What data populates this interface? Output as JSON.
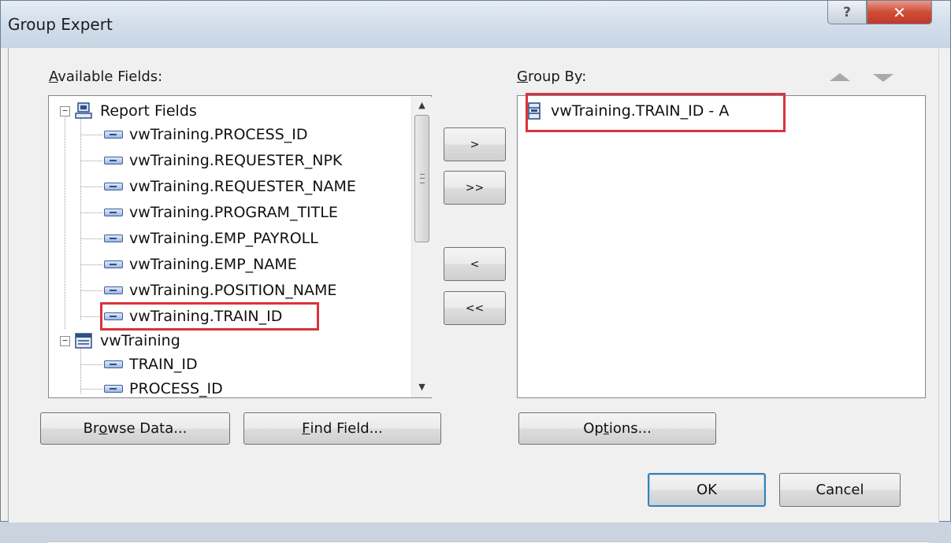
{
  "window": {
    "title": "Group Expert",
    "help_glyph": "?",
    "close_glyph": "✕"
  },
  "available_fields": {
    "label_prefix_ul": "A",
    "label_rest": "vailable Fields:",
    "tree": {
      "root_label": "Report Fields",
      "report_fields": [
        "vwTraining.PROCESS_ID",
        "vwTraining.REQUESTER_NPK",
        "vwTraining.REQUESTER_NAME",
        "vwTraining.PROGRAM_TITLE",
        "vwTraining.EMP_PAYROLL",
        "vwTraining.EMP_NAME",
        "vwTraining.POSITION_NAME",
        "vwTraining.TRAIN_ID"
      ],
      "table_label": "vwTraining",
      "table_fields": [
        "TRAIN_ID",
        "PROCESS_ID"
      ],
      "collapse_glyph": "−"
    },
    "scroll_up_glyph": "▲",
    "scroll_down_glyph": "▼"
  },
  "transfer_buttons": {
    "add": ">",
    "add_all": ">>",
    "remove": "<",
    "remove_all": "<<"
  },
  "group_by": {
    "label_prefix_ul": "G",
    "label_rest": "roup By:",
    "items": [
      "vwTraining.TRAIN_ID - A"
    ]
  },
  "buttons": {
    "browse_pre": "Br",
    "browse_ul": "o",
    "browse_post": "wse Data...",
    "find_ul": "F",
    "find_post": "ind Field...",
    "options_pre": "Op",
    "options_ul": "t",
    "options_post": "ions...",
    "ok": "OK",
    "cancel": "Cancel"
  },
  "colors": {
    "highlight_box": "#d9333c",
    "close_button": "#c0392b"
  }
}
